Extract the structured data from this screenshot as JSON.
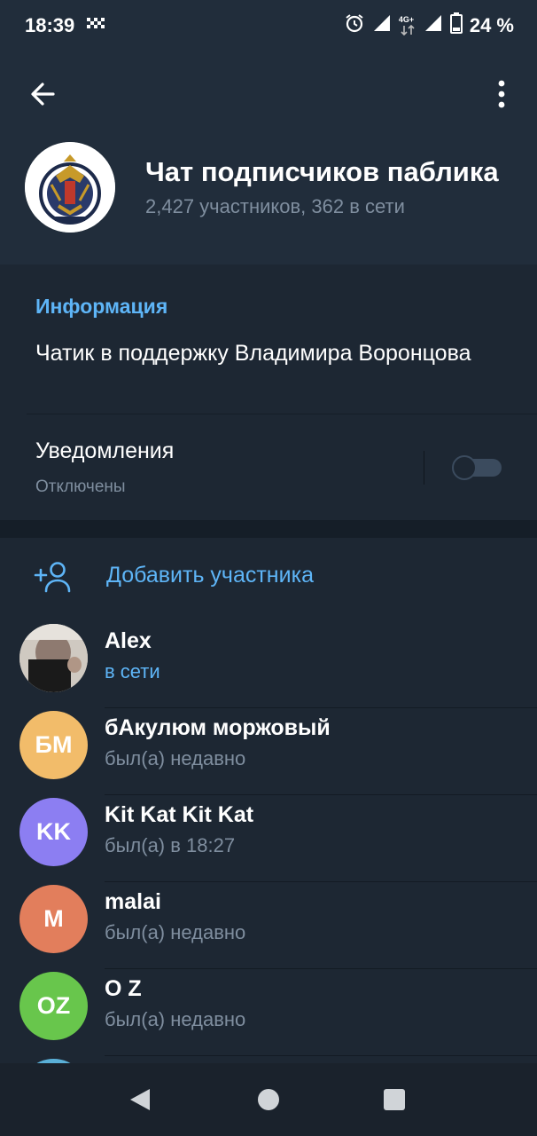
{
  "status_bar": {
    "time": "18:39",
    "network": "4G+",
    "battery": "24 %"
  },
  "header": {
    "title": "Чат подписчиков паблика",
    "subtitle": "2,427 участников, 362 в сети",
    "back_icon": "arrow-left-icon",
    "more_icon": "more-vertical-icon"
  },
  "info": {
    "section_label": "Информация",
    "description": "Чатик в поддержку Владимира Воронцова",
    "notifications_label": "Уведомления",
    "notifications_status": "Отключены",
    "notifications_enabled": false
  },
  "members": {
    "add_label": "Добавить участника",
    "list": [
      {
        "name": "Alex",
        "status": "в сети",
        "online": true,
        "initials": "",
        "color": "#c9c2bb"
      },
      {
        "name": "бАкулюм моржовый",
        "status": "был(а) недавно",
        "online": false,
        "initials": "БМ",
        "color": "#f2bc6a"
      },
      {
        "name": "Kit Kat Kit Kat",
        "status": "был(а) в 18:27",
        "online": false,
        "initials": "KK",
        "color": "#8c7ef2"
      },
      {
        "name": "malai",
        "status": "был(а) недавно",
        "online": false,
        "initials": "M",
        "color": "#e27e5c"
      },
      {
        "name": "O Z",
        "status": "был(а) недавно",
        "online": false,
        "initials": "OZ",
        "color": "#68c64c"
      }
    ]
  },
  "colors": {
    "accent": "#5eb5f7",
    "background": "#1d2733",
    "header_bg": "#212d3b",
    "secondary_text": "#7f8e9f"
  }
}
